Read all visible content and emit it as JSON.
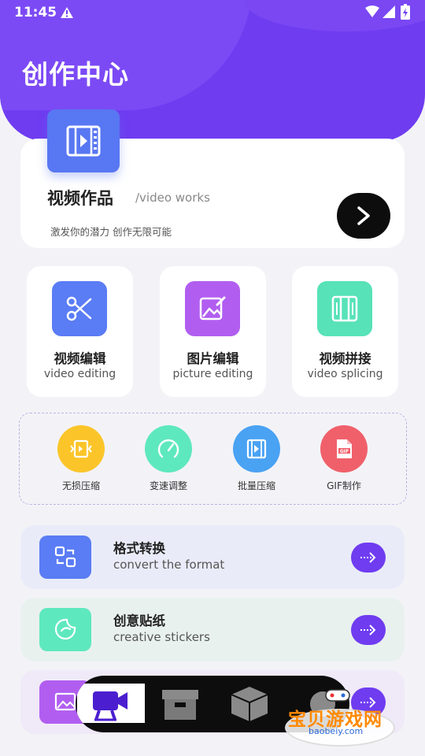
{
  "status_bar": {
    "time": "11:45"
  },
  "header": {
    "title": "创作中心"
  },
  "video_works": {
    "title": "视频作品",
    "subtitle": "/video works",
    "slogan": "激发你的潜力 创作无限可能",
    "icon": "video-film-icon"
  },
  "tools": [
    {
      "title": "视频编辑",
      "subtitle": "video editing",
      "icon": "scissors-icon",
      "color": "#5a7cf4"
    },
    {
      "title": "图片编辑",
      "subtitle": "picture editing",
      "icon": "image-edit-icon",
      "color": "#b15ef0"
    },
    {
      "title": "视频拼接",
      "subtitle": "video splicing",
      "icon": "splice-icon",
      "color": "#57e2b8"
    }
  ],
  "quick_tools": [
    {
      "label": "无损压缩",
      "icon": "compress-icon",
      "color": "#fbc52a"
    },
    {
      "label": "变速调整",
      "icon": "speed-gauge-icon",
      "color": "#5ee8bd"
    },
    {
      "label": "批量压缩",
      "icon": "batch-compress-icon",
      "color": "#4aa2f3"
    },
    {
      "label": "GIF制作",
      "icon": "gif-file-icon",
      "color": "#f0606a"
    }
  ],
  "features": [
    {
      "title": "格式转换",
      "subtitle": "convert the format",
      "icon": "convert-icon",
      "color": "#5a7cf4",
      "background": "#e9ecf8"
    },
    {
      "title": "创意贴纸",
      "subtitle": "creative stickers",
      "icon": "sticker-icon",
      "color": "#5ee8bd",
      "background": "#e9f1ef"
    },
    {
      "title": "",
      "subtitle": "",
      "icon": "image-icon",
      "color": "#b15ef0",
      "background": "#f0e9f8"
    }
  ],
  "dock": [
    {
      "icon": "video-camera-icon"
    },
    {
      "icon": "archive-box-icon"
    },
    {
      "icon": "package-cube-icon"
    },
    {
      "icon": "more-icon"
    }
  ],
  "watermark": {
    "text": "宝贝游戏网",
    "url": "baobeiy.com"
  },
  "colors": {
    "accent": "#6f3cf0",
    "background": "#f3f3f7"
  }
}
